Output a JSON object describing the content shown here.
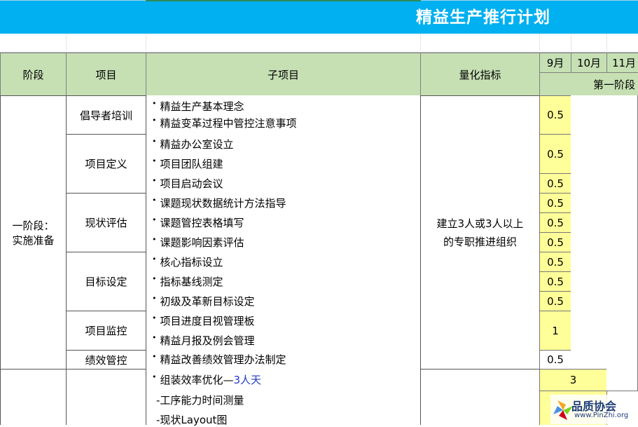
{
  "title": "精益生产推行计划",
  "headers": {
    "stage": "阶段",
    "project": "项目",
    "subitem": "子项目",
    "metric": "量化指标",
    "months": [
      "9月",
      "10月",
      "11月"
    ],
    "phase": "第一阶段"
  },
  "stage1": {
    "name_line1": "一阶段：",
    "name_line2": "实施准备",
    "metric_line1": "建立3人或3人以上",
    "metric_line2": "的专职推进组织"
  },
  "projects": [
    "倡导者培训",
    "项目定义",
    "现状评估",
    "目标设定",
    "项目监控",
    "绩效管控"
  ],
  "subitems": [
    "精益生产基本理念",
    "精益变革过程中管控注意事项",
    "精益办公室设立",
    "项目团队组建",
    "项目启动会议",
    "课题现状数据统计方法指导",
    "课题管控表格填写",
    "课题影响因素评估",
    "核心指标设立",
    "指标基线测定",
    "初级及革新目标设定",
    "项目进度目视管理板",
    "精益月报及例会管理",
    "精益改善绩效管理办法制定"
  ],
  "bullet": "•",
  "days": {
    "d1": "0.5",
    "d2": "0.5",
    "d3": "0.5",
    "d4": "0.5",
    "d5": "0.5",
    "d6": "0.5",
    "d7": "0.5",
    "d8": "0.5",
    "d9": "0.5",
    "d10": "1",
    "d11": "0.5",
    "d12": "3"
  },
  "stage2": {
    "sub_main_text": "组装效率优化—",
    "sub_main_highlight": "3人天",
    "sub_a": "-工序能力时间测量",
    "sub_b": "-现状Layout图"
  },
  "watermark": {
    "name": "品质协会",
    "url": "www.PinZhi.org"
  }
}
